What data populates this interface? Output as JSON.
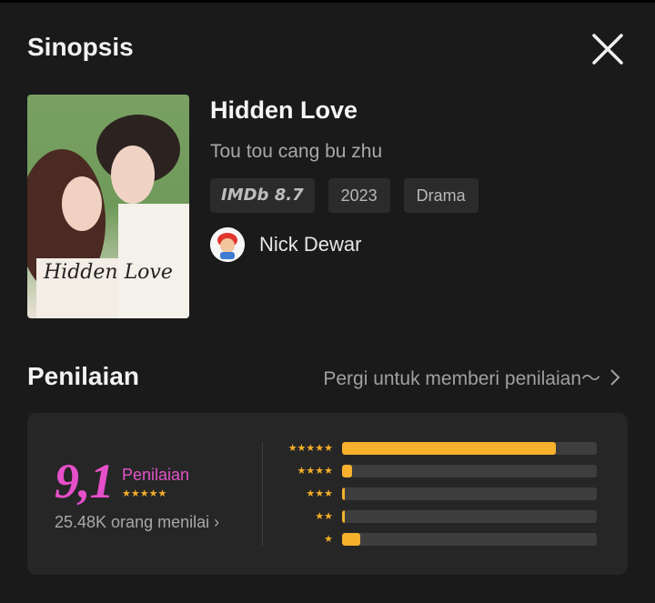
{
  "header": {
    "title": "Sinopsis"
  },
  "movie": {
    "title": "Hidden Love",
    "subtitle": "Tou tou cang bu zhu",
    "poster_text": "Hidden Love",
    "chips": [
      "IMDb 8.7",
      "2023",
      "Drama"
    ],
    "director": "Nick Dewar"
  },
  "rating": {
    "section_title": "Penilaian",
    "link_text": "Pergi untuk memberi penilaian～",
    "score": "9,1",
    "score_label": "Penilaian",
    "score_stars": "★★★★★",
    "voters": "25.48K orang menilai ›",
    "bars": [
      {
        "stars": "★★★★★",
        "fraction": 0.84
      },
      {
        "stars": "★★★★",
        "fraction": 0.04
      },
      {
        "stars": "★★★",
        "fraction": 0.01
      },
      {
        "stars": "★★",
        "fraction": 0.01
      },
      {
        "stars": "★",
        "fraction": 0.07
      }
    ]
  },
  "colors": {
    "background": "#1a1a1a",
    "card": "#262626",
    "accent_pink": "#e54fc9",
    "bar_fill": "#f7b12c",
    "track": "#3e3e3e"
  },
  "icons": {
    "close": "close-icon",
    "chevron": "chevron-right-icon"
  }
}
